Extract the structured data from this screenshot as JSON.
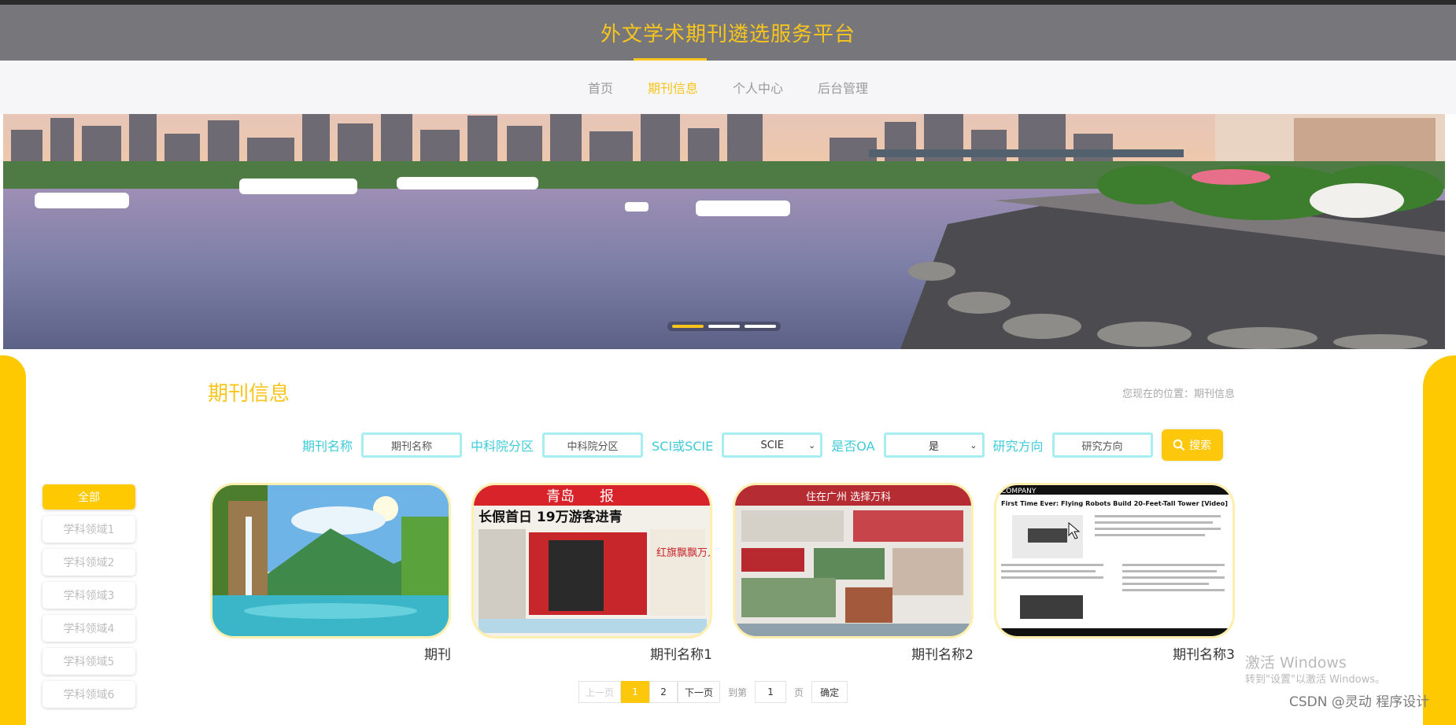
{
  "header": {
    "title": "外文学术期刊遴选服务平台"
  },
  "nav": {
    "items": [
      {
        "label": "首页"
      },
      {
        "label": "期刊信息"
      },
      {
        "label": "个人中心"
      },
      {
        "label": "后台管理"
      }
    ],
    "active_index": 1
  },
  "banner": {
    "dot_count": 3,
    "active_dot": 0
  },
  "page": {
    "title": "期刊信息",
    "breadcrumb": "您现在的位置：期刊信息"
  },
  "search": {
    "name_label": "期刊名称",
    "name_placeholder": "期刊名称",
    "zone_label": "中科院分区",
    "zone_placeholder": "中科院分区",
    "sci_label": "SCI或SCIE",
    "sci_value": "SCIE",
    "oa_label": "是否OA",
    "oa_value": "是",
    "direction_label": "研究方向",
    "direction_placeholder": "研究方向",
    "button_label": "搜索"
  },
  "categories": [
    "全部",
    "学科领域1",
    "学科领域2",
    "学科领域3",
    "学科领域4",
    "学科领域5",
    "学科领域6"
  ],
  "cards": [
    {
      "name": "期刊",
      "image": "waterfall-landscape"
    },
    {
      "name": "期刊名称1",
      "image": "newspaper-qingdao"
    },
    {
      "name": "期刊名称2",
      "image": "newspaper-guangzhou"
    },
    {
      "name": "期刊名称3",
      "image": "article-flying-robots"
    }
  ],
  "newspaper": {
    "masthead": "青岛",
    "masthead_right": "报",
    "headline": "长假首日 19万游客进青",
    "side_text": "红旗飘飘万人聚观",
    "paper2_head": "住在广州 选择万科",
    "article_title": "First Time Ever: Flying Robots Build 20-Feet-Tall Tower [Video]",
    "article_source": "COMPANY"
  },
  "pagination": {
    "prev": "上一页",
    "pages": [
      "1",
      "2"
    ],
    "current": "1",
    "next": "下一页",
    "goto_label": "到第",
    "goto_value": "1",
    "page_unit": "页",
    "confirm": "确定"
  },
  "watermark": {
    "line1": "激活 Windows",
    "line2": "转到\"设置\"以激活 Windows。",
    "csdn": "CSDN @灵动 程序设计"
  },
  "colors": {
    "accent": "#f7c51d",
    "teal": "#3fcbd8",
    "header_bg": "#77777b"
  }
}
